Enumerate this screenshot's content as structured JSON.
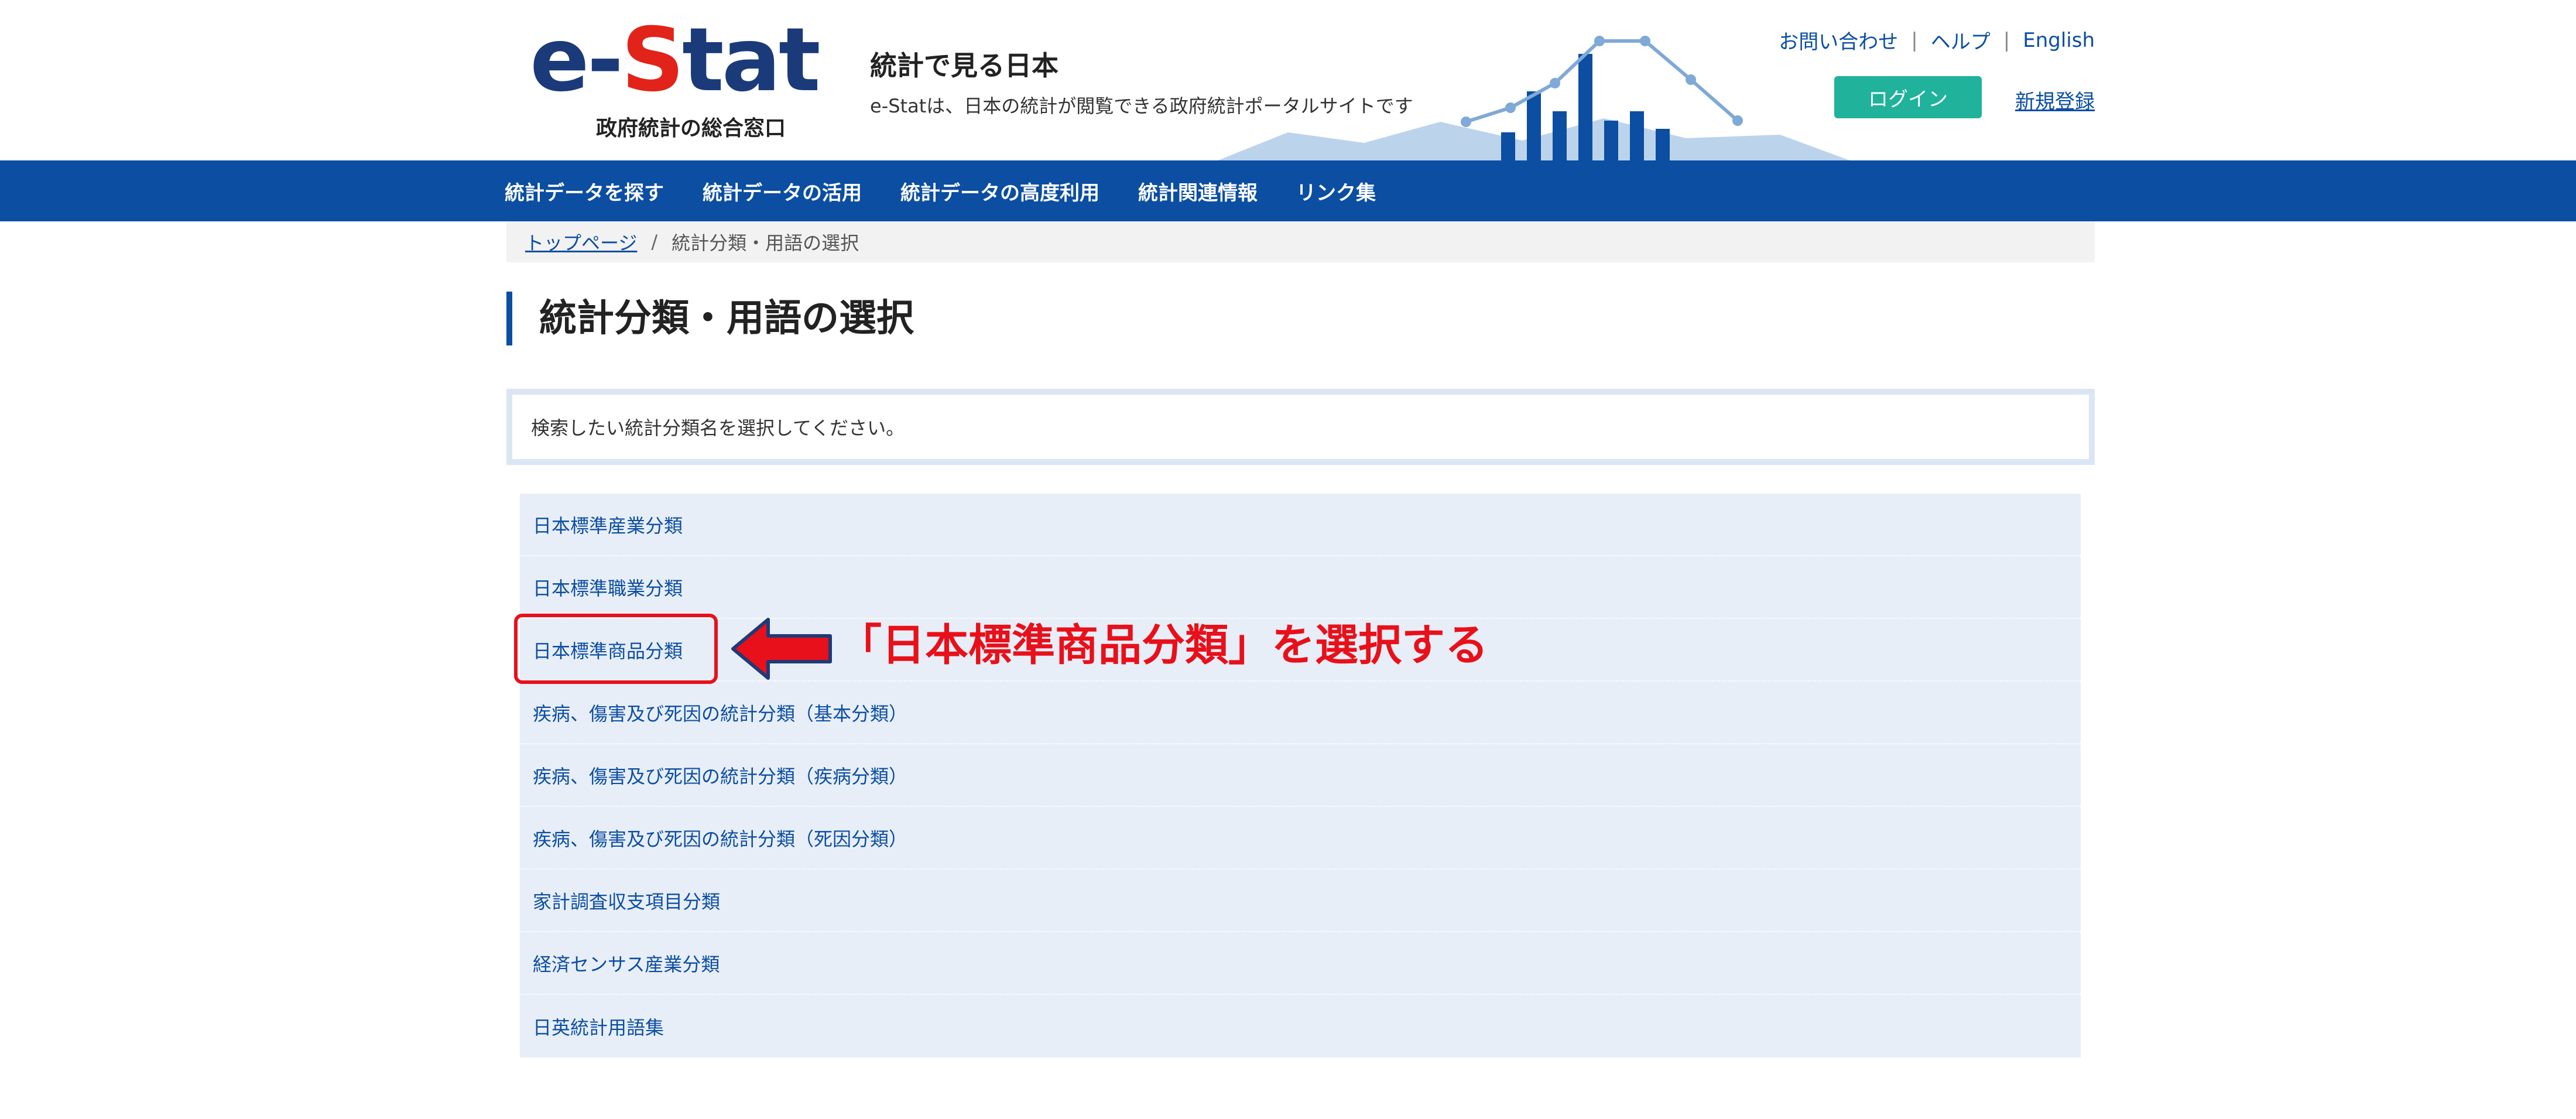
{
  "header": {
    "logo_text_prefix": "e-",
    "logo_text_s": "S",
    "logo_text_suffix": "tat",
    "logo_subtitle": "政府統計の総合窓口",
    "tagline_title": "統計で見る日本",
    "tagline_desc": "e-Statは、日本の統計が閲覧できる政府統計ポータルサイトです",
    "top_links": {
      "contact": "お問い合わせ",
      "help": "ヘルプ",
      "english": "English",
      "separator": "|"
    },
    "login_label": "ログイン",
    "register_label": "新規登録"
  },
  "nav": {
    "items": [
      "統計データを探す",
      "統計データの活用",
      "統計データの高度利用",
      "統計関連情報",
      "リンク集"
    ]
  },
  "breadcrumb": {
    "home": "トップページ",
    "separator": "/",
    "current": "統計分類・用語の選択"
  },
  "page_title": "統計分類・用語の選択",
  "instruction": "検索したい統計分類名を選択してください。",
  "classifications": [
    "日本標準産業分類",
    "日本標準職業分類",
    "日本標準商品分類",
    "疾病、傷害及び死因の統計分類（基本分類）",
    "疾病、傷害及び死因の統計分類（疾病分類）",
    "疾病、傷害及び死因の統計分類（死因分類）",
    "家計調査収支項目分類",
    "経済センサス産業分類",
    "日英統計用語集"
  ],
  "annotation": {
    "text": "「日本標準商品分類」を選択する",
    "color": "#e8101a"
  },
  "colors": {
    "brand_blue": "#0b4ea2",
    "login_green": "#20b29a",
    "logo_red": "#e2231a",
    "list_bg": "#e8eef7"
  }
}
